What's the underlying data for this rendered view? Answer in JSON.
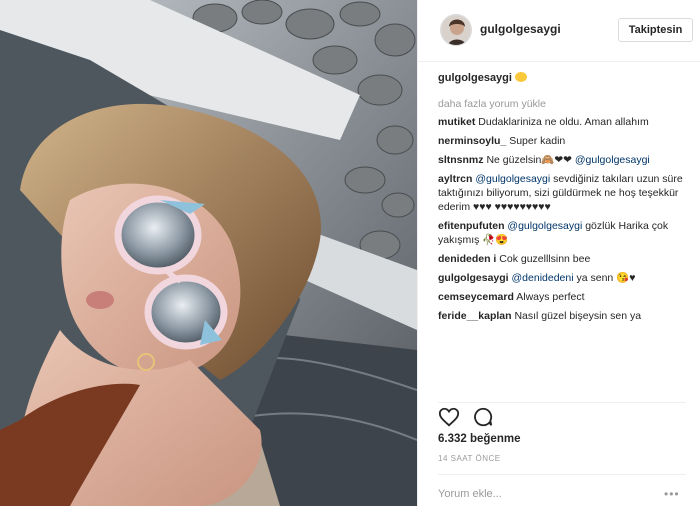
{
  "header": {
    "username": "gulgolgesaygi",
    "follow_label": "Takiptesin"
  },
  "caption": {
    "username": "gulgolgesaygi",
    "emoji": "sun-smile-emoji"
  },
  "load_more_label": "daha fazla yorum yükle",
  "comments": [
    {
      "user": "mutiket",
      "parts": [
        {
          "text": "Dudaklariniza ne oldu. Aman allahım"
        }
      ]
    },
    {
      "user": "nerminsoylu_",
      "parts": [
        {
          "text": "Super kadin"
        }
      ]
    },
    {
      "user": "sltnsnmz",
      "parts": [
        {
          "text": "Ne güzelsin🙈❤❤ "
        },
        {
          "mention": "@gulgolgesaygi"
        }
      ]
    },
    {
      "user": "ayltrcn",
      "parts": [
        {
          "mention": "@gulgolgesaygi"
        },
        {
          "text": " sevdiğiniz takıları uzun süre taktığınızı biliyorum, sizi güldürmek ne hoş teşekkür ederim ♥♥♥ ♥♥♥♥♥♥♥♥♥"
        }
      ]
    },
    {
      "user": "efitenpufuten",
      "parts": [
        {
          "mention": "@gulgolgesaygi"
        },
        {
          "text": " gözlük Harika çok yakışmış 🥀😍"
        }
      ]
    },
    {
      "user": "denideden i",
      "parts": [
        {
          "text": "Cok guzelllsinn bee"
        }
      ]
    },
    {
      "user": "gulgolgesaygi",
      "parts": [
        {
          "mention": "@denidedeni"
        },
        {
          "text": " ya senn 😘♥"
        }
      ]
    },
    {
      "user": "cemseycemard",
      "parts": [
        {
          "text": "Always perfect"
        }
      ]
    },
    {
      "user": "feride__kaplan",
      "parts": [
        {
          "text": "Nasıl güzel bişeysin sen ya"
        }
      ]
    }
  ],
  "actions": {
    "like_icon": "heart-icon",
    "comment_icon": "comment-icon"
  },
  "likes_label": "6.332 beğenme",
  "time_label": "14 SAAT ÖNCE",
  "comment_placeholder": "Yorum ekle...",
  "more_label": "•••",
  "colors": {
    "mention": "#003569",
    "muted": "#999999",
    "text": "#262626",
    "border": "#efefef"
  }
}
